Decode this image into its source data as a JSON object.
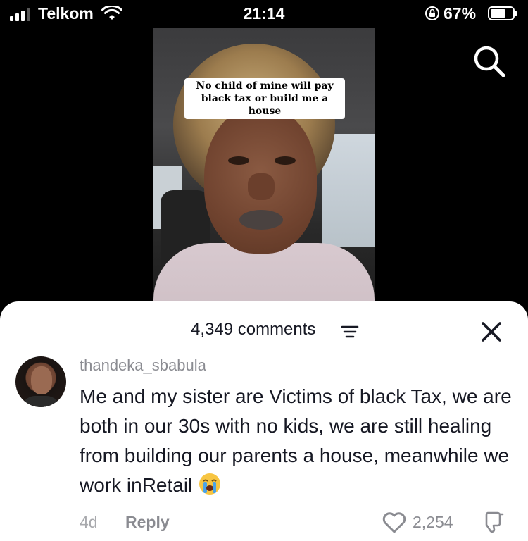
{
  "status_bar": {
    "carrier": "Telkom",
    "time": "21:14",
    "battery_percent": "67%",
    "battery_level": 0.67,
    "icons": [
      "signal-icon",
      "wifi-icon",
      "orientation-lock-icon",
      "battery-icon"
    ]
  },
  "video": {
    "caption": "No child of mine will pay black tax or build me a house"
  },
  "top_bar": {
    "search_icon": "search-icon"
  },
  "comments_sheet": {
    "count_label": "4,349 comments",
    "filter_icon": "filter-icon",
    "close_icon": "close-icon",
    "comment": {
      "username": "thandeka_sbabula",
      "text": "Me and my sister are Victims of black Tax, we are both in our 30s with no kids, we are still healing from building our parents a house, meanwhile we work inRetail",
      "emoji": "loudly-crying-face",
      "time_ago": "4d",
      "reply_label": "Reply",
      "like_count": "2,254"
    }
  },
  "colors": {
    "text_primary": "#161823",
    "text_secondary": "#8a8b91",
    "sheet_background": "#ffffff",
    "page_background": "#000000"
  }
}
